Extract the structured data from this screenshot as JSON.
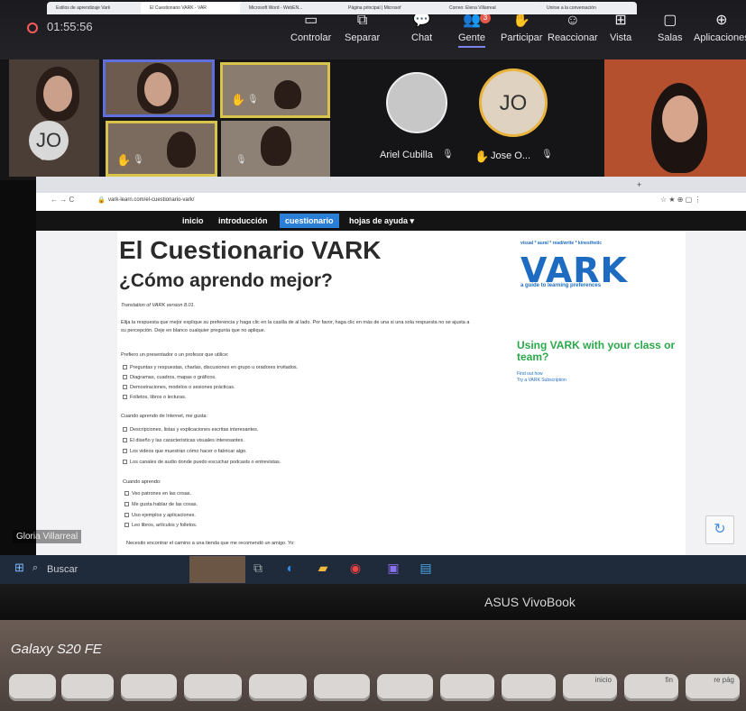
{
  "teams": {
    "timer": "01:55:56",
    "buttons": [
      "Controlar",
      "Separar",
      "Chat",
      "Gente",
      "Participar",
      "Reaccionar",
      "Vista",
      "Salas",
      "Aplicaciones"
    ],
    "people_badge": "3",
    "tile_initials_small": "JO",
    "participants": [
      {
        "name": "Ariel Cubilla"
      },
      {
        "name": "Jose O...",
        "initials": "JO"
      }
    ]
  },
  "browser": {
    "tabs": [
      "Estilos de aprendizaje Vark",
      "El Cuestionario VARK - VAR",
      "Microsoft Word - WebEN...",
      "Página principal | Microsof",
      "Correo: Elena Villarreal",
      "Unirse a la conversación"
    ],
    "url": "vark-learn.com/el-cuestionario-vark/"
  },
  "vark": {
    "nav": [
      "inicio",
      "introducción",
      "cuestionario",
      "hojas de ayuda ▾"
    ],
    "title": "El Cuestionario VARK",
    "subtitle": "¿Cómo aprendo mejor?",
    "translation": "Translation of VARK version 8.01.",
    "instructions": "Elija la respuesta que mejor explique su preferencia y haga clic en la casilla de al lado. Por favor, haga clic en más de una si una sola respuesta no se ajusta a su percepción. Deje en blanco cualquier pregunta que no aplique.",
    "q1": "Prefiero un presentador o un profesor que utilice:",
    "q1_options": [
      "Preguntas y respuestas, charlas, discusiones en grupo u oradores invitados.",
      "Diagramas, cuadros, mapas o gráficos.",
      "Demostraciones, modelos o sesiones prácticas.",
      "Folletos, libros o lecturas."
    ],
    "q2": "Cuando aprendo de Internet, me gusta:",
    "q2_options": [
      "Descripciones, listas y explicaciones escritas interesantes.",
      "El diseño y las características visuales interesantes.",
      "Los videos que muestran cómo hacer o fabricar algo.",
      "Los canales de audio donde puedo escuchar podcasts o entrevistas."
    ],
    "q3": "Cuando aprendo:",
    "q3_options": [
      "Veo patrones en las cosas.",
      "Me gusta hablar de las cosas.",
      "Uso ejemplos y aplicaciones.",
      "Leo libros, artículos y folletos."
    ],
    "q4": "Necesito encontrar el camino a una tienda que me recomendó un amigo. Yo:",
    "logo_tag": "visual * aural * read/write * kinesthetic",
    "logo": "VARK",
    "logo_sub": "a guide to learning preferences",
    "using": "Using VARK with your class or team?",
    "links": [
      "Find out how",
      "Try a VARK Subscription"
    ]
  },
  "overlay_name": "Gloria Villarreal",
  "taskbar": {
    "search": "Buscar"
  },
  "laptop": {
    "brand": "ASUS VivoBook"
  },
  "watermark": "Galaxy S20 FE",
  "keys": [
    "inicio",
    "fin",
    "re pág"
  ]
}
